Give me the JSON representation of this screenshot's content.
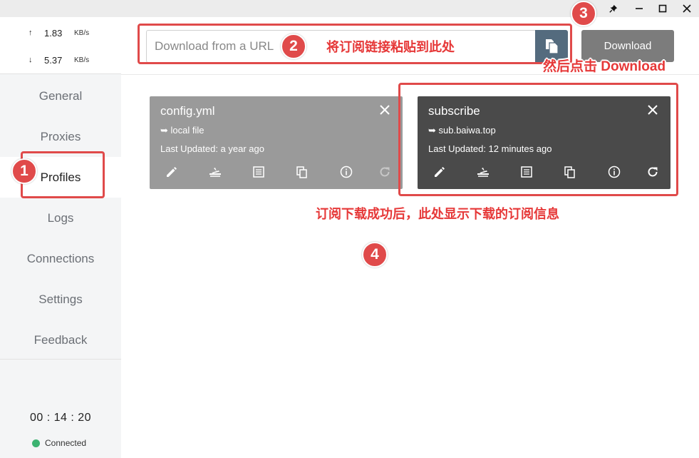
{
  "window_controls": {
    "pin": "pin-icon",
    "minimize": "minimize-icon",
    "maximize": "maximize-icon",
    "close": "close-icon"
  },
  "traffic": {
    "up_arrow": "↑",
    "up_value": "1.83",
    "up_unit": "KB/s",
    "down_arrow": "↓",
    "down_value": "5.37",
    "down_unit": "KB/s"
  },
  "sidebar": {
    "items": [
      {
        "label": "General"
      },
      {
        "label": "Proxies"
      },
      {
        "label": "Profiles"
      },
      {
        "label": "Logs"
      },
      {
        "label": "Connections"
      },
      {
        "label": "Settings"
      },
      {
        "label": "Feedback"
      }
    ],
    "active": "Profiles",
    "timer": "00 : 14 : 20",
    "status": "Connected",
    "status_color": "#3cb371"
  },
  "header": {
    "url_placeholder": "Download from a URL",
    "download_label": "Download",
    "paste_icon": "paste-icon"
  },
  "profiles": [
    {
      "name": "config.yml",
      "source": "➥ local file",
      "updated": "Last Updated: a year ago"
    },
    {
      "name": "subscribe",
      "source": "➥ sub.baiwa.top",
      "updated": "Last Updated: 12 minutes ago"
    }
  ],
  "annotations": {
    "step1": "1",
    "step2": "2",
    "step3": "3",
    "step4": "4",
    "text2": "将订阅链接粘贴到此处",
    "text3": "然后点击 Download",
    "text4": "订阅下载成功后，此处显示下载的订阅信息",
    "color": "#e04a4a"
  }
}
